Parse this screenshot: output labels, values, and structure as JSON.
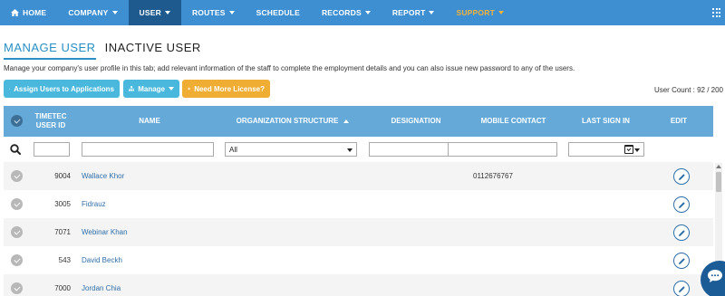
{
  "nav": {
    "home": "HOME",
    "company": "COMPANY",
    "user": "USER",
    "routes": "ROUTES",
    "schedule": "SCHEDULE",
    "records": "RECORDS",
    "report": "REPORT",
    "support": "SUPPORT"
  },
  "tabs": {
    "manage_user": "MANAGE USER",
    "inactive_user": "INACTIVE USER"
  },
  "description": "Manage your company's user profile in this tab; add relevant information of the staff to complete the employment details and you can also issue new password to any of the users.",
  "buttons": {
    "assign": "Assign Users to Applications",
    "manage": "Manage",
    "license": "Need More License?"
  },
  "user_count": "User Count : 92 / 200",
  "columns": {
    "user_id": "TIMETEC USER ID",
    "name": "NAME",
    "org": "ORGANIZATION STRUCTURE",
    "designation": "DESIGNATION",
    "mobile": "MOBILE CONTACT",
    "last_sign_in": "LAST SIGN IN",
    "edit": "EDIT"
  },
  "filters": {
    "org_selected": "All"
  },
  "rows": [
    {
      "id": "9004",
      "name": "Wallace Khor",
      "mobile": "0112676767"
    },
    {
      "id": "3005",
      "name": "Fidrauz",
      "mobile": ""
    },
    {
      "id": "7071",
      "name": "Webinar Khan",
      "mobile": ""
    },
    {
      "id": "543",
      "name": "David Beckh",
      "mobile": ""
    },
    {
      "id": "7000",
      "name": "Jordan Chia",
      "mobile": ""
    }
  ],
  "colors": {
    "nav_bg": "#3d8fd1",
    "nav_active": "#1e5a8e",
    "support": "#f0b23d",
    "header_bg": "#64a9d8",
    "button_info": "#49b8dc",
    "button_warning": "#f0ad34",
    "link": "#2f6fa8"
  },
  "icons": [
    "home-icon",
    "apps-grid-icon",
    "users-icon",
    "sitemap-icon",
    "plus-icon",
    "search-icon",
    "calendar-check-icon",
    "pencil-icon",
    "chat-icon"
  ]
}
